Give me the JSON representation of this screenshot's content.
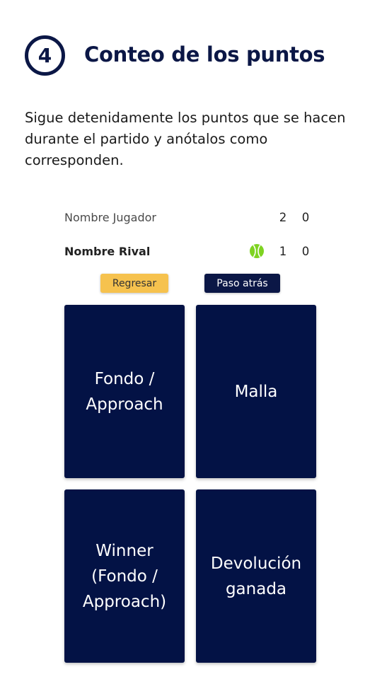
{
  "step": {
    "number": "4",
    "title": "Conteo de los puntos"
  },
  "instructions": "Sigue detenidamente los puntos que se hacen durante el partido y anótalos como corresponden.",
  "scoreboard": {
    "player": {
      "name": "Nombre Jugador",
      "games": "2",
      "points": "0"
    },
    "rival": {
      "name": "Nombre Rival",
      "games": "1",
      "points": "0",
      "serving": true
    }
  },
  "colors": {
    "navy": "#031245",
    "accent_yellow": "#f6c24e",
    "ball_green": "#7ed321"
  },
  "buttons": {
    "back_label": "Regresar",
    "undo_label": "Paso atrás"
  },
  "options": [
    {
      "label": "Fondo /\nApproach"
    },
    {
      "label": "Malla"
    },
    {
      "label": "Winner\n(Fondo /\nApproach)"
    },
    {
      "label": "Devolución\nganada"
    }
  ]
}
